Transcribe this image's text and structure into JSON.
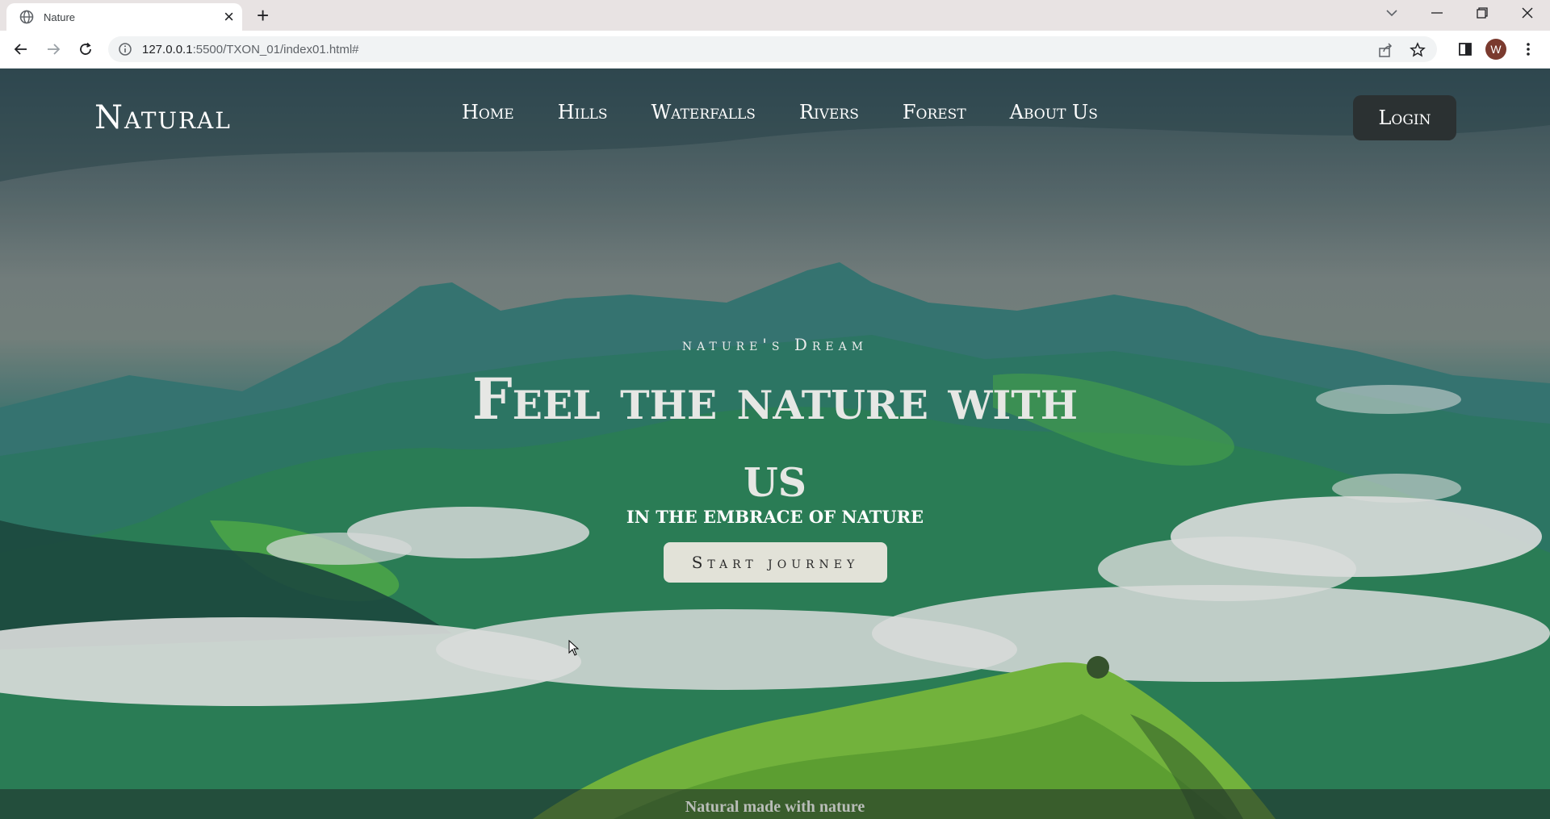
{
  "browser": {
    "tab_title": "Nature",
    "url_host": "127.0.0.1",
    "url_rest": ":5500/TXON_01/index01.html#",
    "profile_initial": "W"
  },
  "site": {
    "brand": "Natural",
    "nav": [
      "Home",
      "Hills",
      "Waterfalls",
      "Rivers",
      "Forest",
      "About Us"
    ],
    "login_label": "Login"
  },
  "hero": {
    "kicker": "nature's Dream",
    "headline": "Feel the nature with us",
    "subheading": "IN THE EMBRACE OF NATURE",
    "cta_label": "Start journey"
  },
  "footer": {
    "text": "Natural made with nature"
  },
  "colors": {
    "login_bg": "#2b3132",
    "cta_bg": "#e2e2d8",
    "sky": "#7b8786",
    "hill_green": "#7cc242"
  }
}
